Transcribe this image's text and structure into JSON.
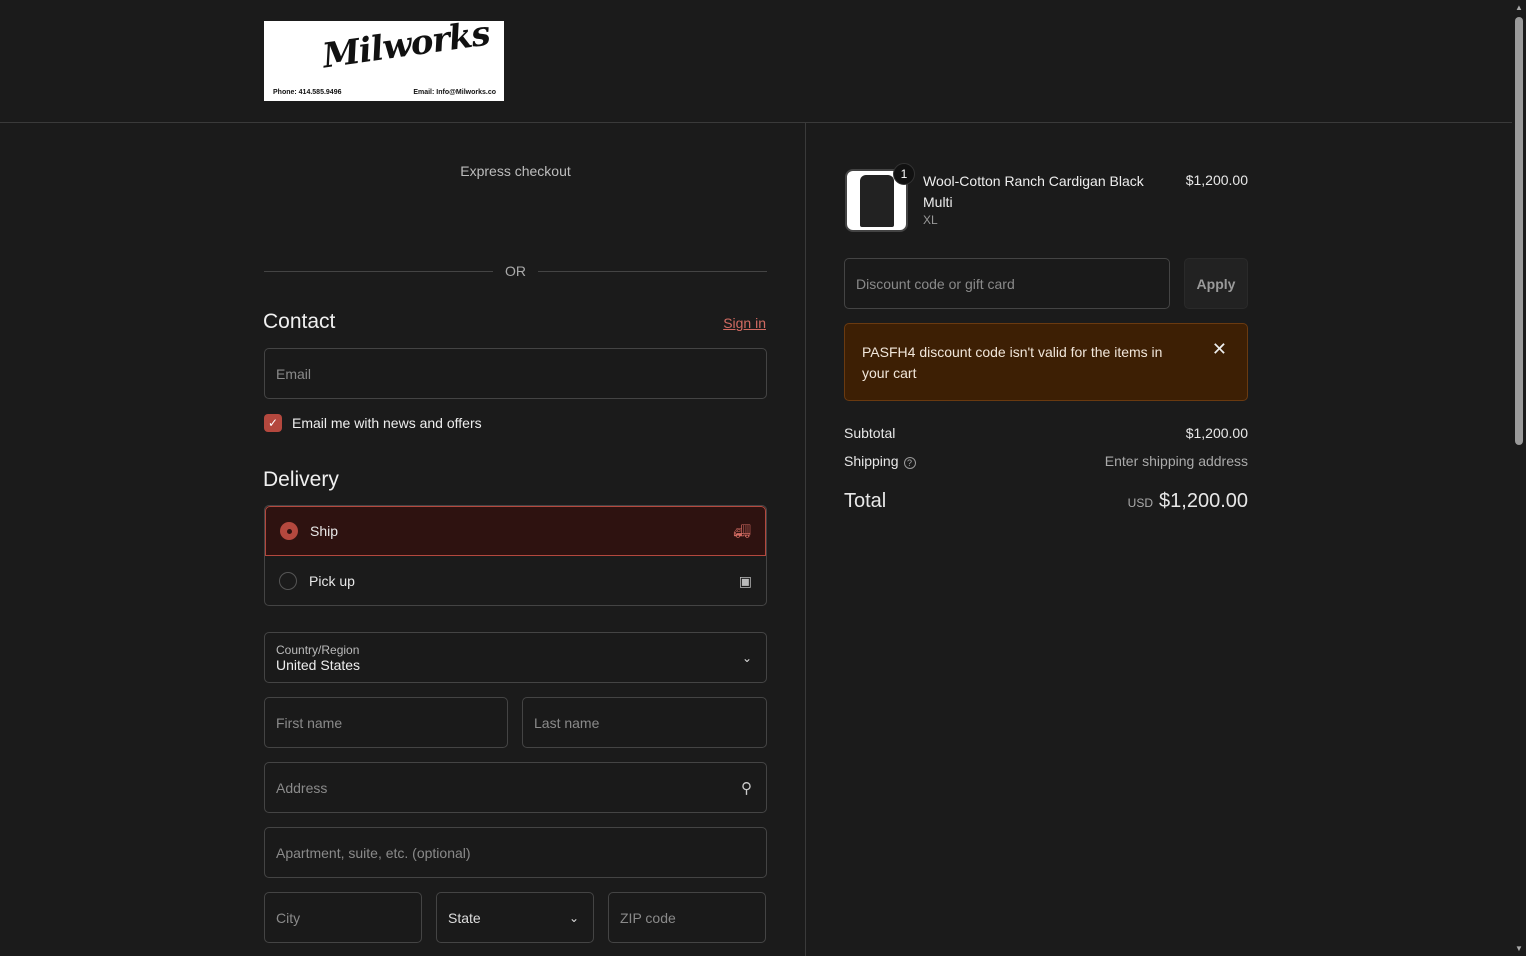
{
  "logo": {
    "brand": "Milworks",
    "phone": "Phone: 414.585.9496",
    "email": "Email: Info@Milworks.co"
  },
  "express_checkout": "Express checkout",
  "or": "OR",
  "contact": {
    "title": "Contact",
    "sign_in": "Sign in",
    "email_placeholder": "Email",
    "newsletter": "Email me with news and offers",
    "newsletter_checked": true
  },
  "delivery": {
    "title": "Delivery",
    "options": [
      {
        "label": "Ship",
        "selected": true,
        "icon": "truck-icon"
      },
      {
        "label": "Pick up",
        "selected": false,
        "icon": "store-icon"
      }
    ],
    "country_label": "Country/Region",
    "country_value": "United States",
    "first_name": "First name",
    "last_name": "Last name",
    "address": "Address",
    "apartment": "Apartment, suite, etc. (optional)",
    "city": "City",
    "state": "State",
    "zip": "ZIP code"
  },
  "summary": {
    "item": {
      "name": "Wool-Cotton Ranch Cardigan Black Multi",
      "variant": "XL",
      "price": "$1,200.00",
      "quantity": "1"
    },
    "discount_placeholder": "Discount code or gift card",
    "apply": "Apply",
    "alert": "PASFH4 discount code isn't valid for the items in your cart",
    "subtotal_label": "Subtotal",
    "subtotal": "$1,200.00",
    "shipping_label": "Shipping",
    "shipping": "Enter shipping address",
    "total_label": "Total",
    "currency": "USD",
    "total": "$1,200.00"
  },
  "colors": {
    "accent": "#b4483e",
    "background": "#1b1b1b",
    "alert_bg": "#3d1f04"
  }
}
